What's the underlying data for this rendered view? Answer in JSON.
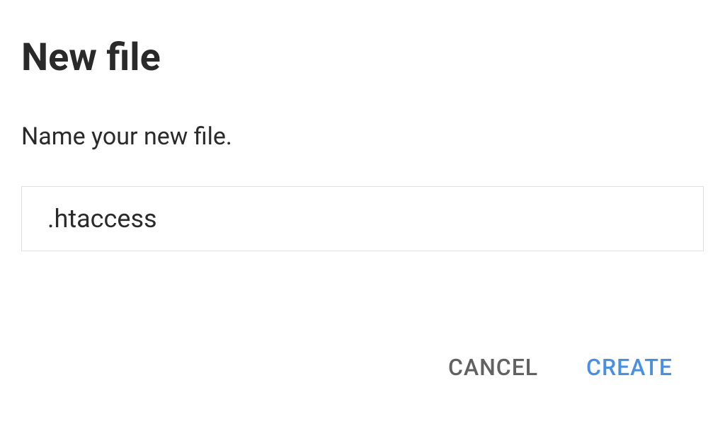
{
  "dialog": {
    "title": "New file",
    "label": "Name your new file.",
    "input_value": ".htaccess",
    "input_placeholder": "",
    "buttons": {
      "cancel_label": "CANCEL",
      "create_label": "CREATE"
    }
  }
}
